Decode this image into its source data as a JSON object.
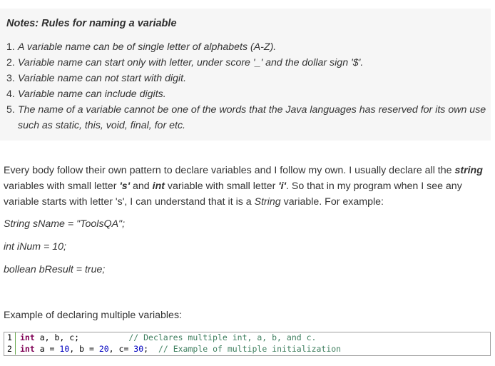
{
  "notes": {
    "title": "Notes: Rules for naming a variable",
    "rules": [
      {
        "num": "1.",
        "text": "A variable name can be of single letter of alphabets (A-Z)."
      },
      {
        "num": "2.",
        "text": "Variable name can start only with letter, under score '_' and the dollar sign '$'."
      },
      {
        "num": "3.",
        "text": "Variable name can not start with digit."
      },
      {
        "num": "4.",
        "text": "Variable name can include digits."
      },
      {
        "num": "5.",
        "text": "The name of a variable cannot be one of the words that the Java languages has reserved for its own use such as static, this, void, final, for etc."
      }
    ]
  },
  "paragraph": {
    "p1": "Every body follow their own pattern to declare variables and I follow my own. I usually declare all the ",
    "string_kw": "string",
    "p2": " variables with small letter ",
    "s_letter": "'s'",
    "p3": " and ",
    "int_kw": "int",
    "p4": " variable with small letter ",
    "i_letter": "'i'",
    "p5": ". So that in my program when I see any variable starts with letter 's', I can understand that it is a ",
    "string_word": "String",
    "p6": " variable. For example:"
  },
  "examples": [
    "String sName = \"ToolsQA\";",
    "int iNum = 10;",
    "bollean bResult = true;"
  ],
  "multi_label": "Example of declaring multiple variables:",
  "code": {
    "lines": [
      {
        "num": "1",
        "kw": "int",
        "rest": " a, b, c;          ",
        "comment": "// Declares multiple int, a, b, and c."
      },
      {
        "num": "2",
        "kw": "int",
        "rest_a": " a = ",
        "n1": "10",
        "rest_b": ", b = ",
        "n2": "20",
        "rest_c": ", c= ",
        "n3": "30",
        "rest_d": ";  ",
        "comment": "// Example of multiple initialization"
      }
    ]
  }
}
